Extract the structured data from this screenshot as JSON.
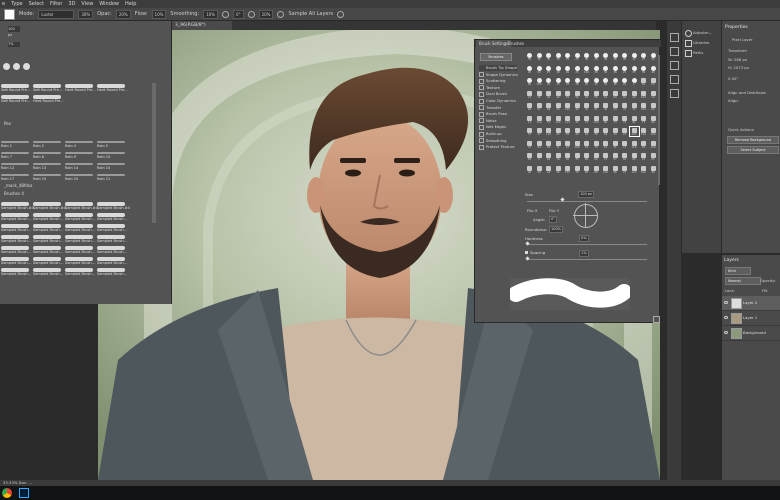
{
  "menu": [
    "e",
    "Type",
    "Select",
    "Filter",
    "3D",
    "View",
    "Window",
    "Help"
  ],
  "options": {
    "mode_label": "Mode:",
    "mode_value": "Luster",
    "size": "30%",
    "opacity_label": "Opac:",
    "opacity": "20%",
    "flow_label": "Flow:",
    "flow": "10%",
    "smooth_label": "Smoothing:",
    "smooth": "10%",
    "angle": "0°",
    "pressure": "20%",
    "sample_label": "Sample All Layers"
  },
  "document_tab": "3_96(RGB/8*)",
  "brush_panel": {
    "size_value": "100 px",
    "size_pct": "7%",
    "row1": [
      "Soft Round Pre...",
      "Soft Round Pre...",
      "Hard Round Pre...",
      "Hard Round Pre..."
    ],
    "row1b": [
      "Soft Round Pre...",
      "Hard Round Pre..."
    ],
    "group_mid": "Pex",
    "rain_rows": [
      [
        "Rain 1",
        "Rain 2",
        "Rain 4",
        "Rain 5"
      ],
      [
        "Rain 7",
        "Rain 8",
        "Rain 9",
        "Rain 10"
      ],
      [
        "Rain 12",
        "Rain 13",
        "Rain 14",
        "Rain 15"
      ],
      [
        "Rain 17",
        "Rain 19",
        "Rain 20",
        "Rain 21"
      ]
    ],
    "group_a": "_mack_48fdsa",
    "group_b": "Brushes 4",
    "sampled_rows": [
      [
        "Sampled Brush #3",
        "Sampled Brush #4",
        "Sampled Brush #4",
        "Sampled Brush #4"
      ],
      [
        "Sampled Brush...",
        "Sampled Brush...",
        "Sampled Brush...",
        "Sampled Brush..."
      ],
      [
        "Sampled Brush...",
        "Sampled Brush...",
        "Sampled Brush...",
        "Sampled Brush..."
      ],
      [
        "Sampled Brush...",
        "Sampled Brush...",
        "Sampled Brush...",
        "Sampled Brush..."
      ],
      [
        "Sampled Brush...",
        "Sampled Brush...",
        "Sampled Brush...",
        "Sampled Brush..."
      ],
      [
        "Sampled Brush...",
        "Sampled Brush...",
        "Sampled Brush...",
        "Sampled Brush..."
      ],
      [
        "Sampled Brush...",
        "Sampled Brush...",
        "Sampled Brush...",
        "Sampled Brush..."
      ]
    ]
  },
  "brush_settings": {
    "tab1": "Brush Settings",
    "tab2": "Brushes",
    "brushes_btn": "Brushes",
    "options": [
      "Brush Tip Shape",
      "Shape Dynamics",
      "Scattering",
      "Texture",
      "Dual Brush",
      "Color Dynamics",
      "Transfer",
      "Brush Pose",
      "Noise",
      "Wet Edges",
      "Build-up",
      "Smoothing",
      "Protect Texture"
    ],
    "tip_numbers": [
      "30",
      "30",
      "30",
      "25",
      "25",
      "25",
      "36",
      "25",
      "36",
      "36",
      "36",
      "32",
      "25",
      "50",
      "25",
      "50",
      "25",
      "20",
      "26",
      "25",
      "100",
      "28",
      "36",
      "36",
      "25",
      "25",
      "30",
      "40",
      "60",
      "100",
      "20",
      "25",
      "43",
      "36",
      "42",
      "50",
      "54",
      "36",
      "20",
      "1",
      "50",
      "50",
      "23",
      "45",
      "40",
      "40",
      "70",
      "56",
      "48",
      "56",
      "61",
      "63",
      "45",
      "40",
      "100",
      "14",
      "48",
      "97",
      "68",
      "28",
      "100",
      "46",
      "30",
      "51",
      "36",
      "43",
      "70",
      "50",
      "100",
      "60",
      "11",
      "119",
      "52",
      "190",
      "114",
      "45",
      "74",
      "150",
      "60",
      "73",
      "79",
      "92",
      "73",
      "66",
      "57",
      "97",
      "110",
      "95",
      "65",
      "45",
      "64",
      "36",
      "28",
      "34",
      "23",
      "200",
      "124",
      "120",
      "37",
      "64",
      "46",
      "71",
      "63",
      "105",
      "54",
      "70",
      "55",
      "71",
      "73",
      "116",
      "54",
      "100",
      "83",
      "5",
      "18",
      "76",
      "50",
      "35",
      "80",
      "60",
      "73",
      "57",
      "84",
      "60",
      "53",
      "65",
      "26",
      "30",
      "24",
      "25",
      "130",
      "70",
      "90",
      "80",
      "110",
      "36",
      "75",
      "113",
      "120",
      "40"
    ],
    "size_label": "Size",
    "size_value": "100 px",
    "flipx": "Flip X",
    "flipy": "Flip Y",
    "angle_label": "Angle:",
    "angle_value": "0°",
    "roundness_label": "Roundness:",
    "roundness_value": "100%",
    "hardness_label": "Hardness",
    "hardness_value": "0%",
    "spacing_label": "Spacing",
    "spacing_value": "1%"
  },
  "right": {
    "adj_items": [
      "Adjustm...",
      "Libraries",
      "Paths"
    ],
    "properties_title": "Properties",
    "pixel_layer": "Pixel Layer",
    "transform_label": "Transform",
    "w": "W: 288 px",
    "h": "H: 2073 px",
    "x": "X: 187 px",
    "y": "Y: 0 px",
    "angle": "0.00°",
    "align_label": "Align and Distribute",
    "align_sub": "Align:",
    "quick_label": "Quick Actions",
    "remove_bg": "Remove Background",
    "select_subject": "Select Subject",
    "layers_title": "Layers",
    "kind": "Kind",
    "blend": "Normal",
    "opacity": "Opacity:",
    "lock": "Lock:",
    "fill": "Fill:",
    "layers": [
      "Layer 2",
      "Layer 1",
      "Background"
    ]
  },
  "status": "33.33%  Doc: ...",
  "colors": {
    "accent": "#0a84ff",
    "panel": "#535353",
    "ps_blue": "#31a8ff"
  }
}
